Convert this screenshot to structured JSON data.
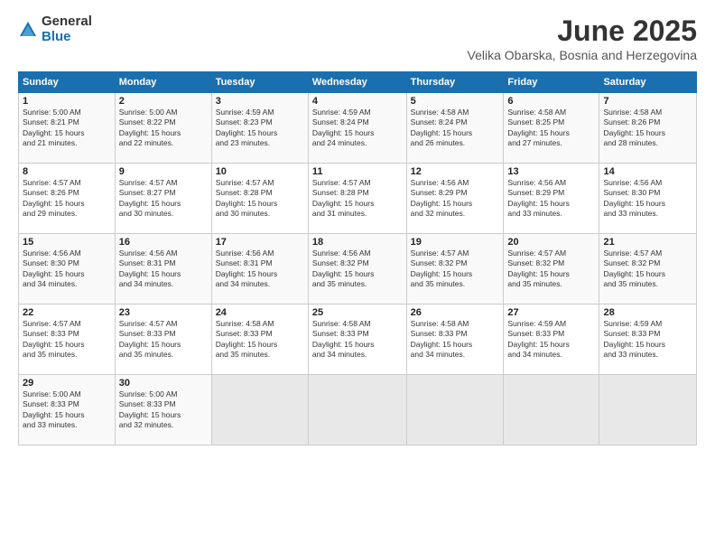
{
  "logo": {
    "general": "General",
    "blue": "Blue"
  },
  "title": "June 2025",
  "subtitle": "Velika Obarska, Bosnia and Herzegovina",
  "days_of_week": [
    "Sunday",
    "Monday",
    "Tuesday",
    "Wednesday",
    "Thursday",
    "Friday",
    "Saturday"
  ],
  "weeks": [
    [
      {
        "day": "1",
        "sunrise": "5:00 AM",
        "sunset": "8:21 PM",
        "daylight": "15 hours and 21 minutes."
      },
      {
        "day": "2",
        "sunrise": "5:00 AM",
        "sunset": "8:22 PM",
        "daylight": "15 hours and 22 minutes."
      },
      {
        "day": "3",
        "sunrise": "4:59 AM",
        "sunset": "8:23 PM",
        "daylight": "15 hours and 23 minutes."
      },
      {
        "day": "4",
        "sunrise": "4:59 AM",
        "sunset": "8:24 PM",
        "daylight": "15 hours and 24 minutes."
      },
      {
        "day": "5",
        "sunrise": "4:58 AM",
        "sunset": "8:24 PM",
        "daylight": "15 hours and 26 minutes."
      },
      {
        "day": "6",
        "sunrise": "4:58 AM",
        "sunset": "8:25 PM",
        "daylight": "15 hours and 27 minutes."
      },
      {
        "day": "7",
        "sunrise": "4:58 AM",
        "sunset": "8:26 PM",
        "daylight": "15 hours and 28 minutes."
      }
    ],
    [
      {
        "day": "8",
        "sunrise": "4:57 AM",
        "sunset": "8:26 PM",
        "daylight": "15 hours and 29 minutes."
      },
      {
        "day": "9",
        "sunrise": "4:57 AM",
        "sunset": "8:27 PM",
        "daylight": "15 hours and 30 minutes."
      },
      {
        "day": "10",
        "sunrise": "4:57 AM",
        "sunset": "8:28 PM",
        "daylight": "15 hours and 30 minutes."
      },
      {
        "day": "11",
        "sunrise": "4:57 AM",
        "sunset": "8:28 PM",
        "daylight": "15 hours and 31 minutes."
      },
      {
        "day": "12",
        "sunrise": "4:56 AM",
        "sunset": "8:29 PM",
        "daylight": "15 hours and 32 minutes."
      },
      {
        "day": "13",
        "sunrise": "4:56 AM",
        "sunset": "8:29 PM",
        "daylight": "15 hours and 33 minutes."
      },
      {
        "day": "14",
        "sunrise": "4:56 AM",
        "sunset": "8:30 PM",
        "daylight": "15 hours and 33 minutes."
      }
    ],
    [
      {
        "day": "15",
        "sunrise": "4:56 AM",
        "sunset": "8:30 PM",
        "daylight": "15 hours and 34 minutes."
      },
      {
        "day": "16",
        "sunrise": "4:56 AM",
        "sunset": "8:31 PM",
        "daylight": "15 hours and 34 minutes."
      },
      {
        "day": "17",
        "sunrise": "4:56 AM",
        "sunset": "8:31 PM",
        "daylight": "15 hours and 34 minutes."
      },
      {
        "day": "18",
        "sunrise": "4:56 AM",
        "sunset": "8:32 PM",
        "daylight": "15 hours and 35 minutes."
      },
      {
        "day": "19",
        "sunrise": "4:57 AM",
        "sunset": "8:32 PM",
        "daylight": "15 hours and 35 minutes."
      },
      {
        "day": "20",
        "sunrise": "4:57 AM",
        "sunset": "8:32 PM",
        "daylight": "15 hours and 35 minutes."
      },
      {
        "day": "21",
        "sunrise": "4:57 AM",
        "sunset": "8:32 PM",
        "daylight": "15 hours and 35 minutes."
      }
    ],
    [
      {
        "day": "22",
        "sunrise": "4:57 AM",
        "sunset": "8:33 PM",
        "daylight": "15 hours and 35 minutes."
      },
      {
        "day": "23",
        "sunrise": "4:57 AM",
        "sunset": "8:33 PM",
        "daylight": "15 hours and 35 minutes."
      },
      {
        "day": "24",
        "sunrise": "4:58 AM",
        "sunset": "8:33 PM",
        "daylight": "15 hours and 35 minutes."
      },
      {
        "day": "25",
        "sunrise": "4:58 AM",
        "sunset": "8:33 PM",
        "daylight": "15 hours and 34 minutes."
      },
      {
        "day": "26",
        "sunrise": "4:58 AM",
        "sunset": "8:33 PM",
        "daylight": "15 hours and 34 minutes."
      },
      {
        "day": "27",
        "sunrise": "4:59 AM",
        "sunset": "8:33 PM",
        "daylight": "15 hours and 34 minutes."
      },
      {
        "day": "28",
        "sunrise": "4:59 AM",
        "sunset": "8:33 PM",
        "daylight": "15 hours and 33 minutes."
      }
    ],
    [
      {
        "day": "29",
        "sunrise": "5:00 AM",
        "sunset": "8:33 PM",
        "daylight": "15 hours and 33 minutes."
      },
      {
        "day": "30",
        "sunrise": "5:00 AM",
        "sunset": "8:33 PM",
        "daylight": "15 hours and 32 minutes."
      },
      null,
      null,
      null,
      null,
      null
    ]
  ]
}
